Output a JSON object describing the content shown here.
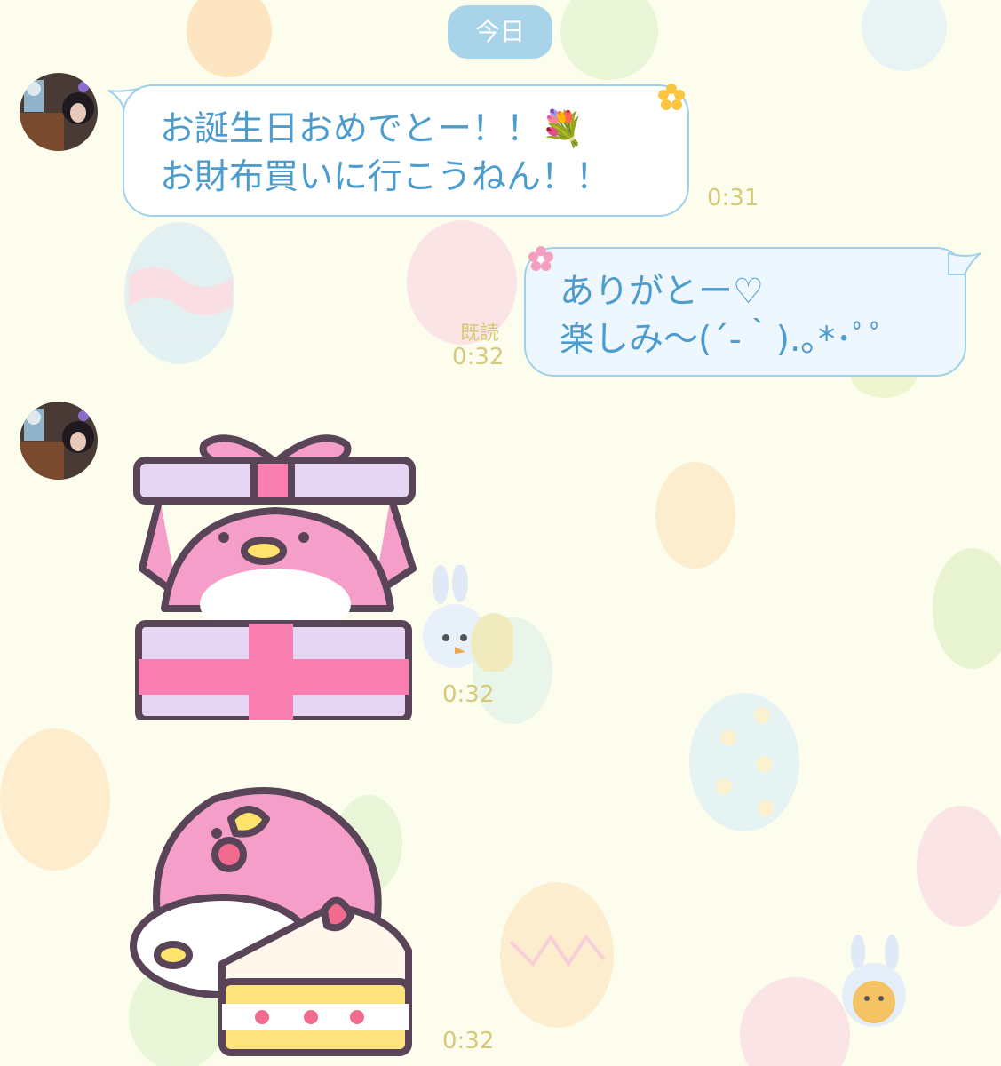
{
  "chat": {
    "date_divider": "今日",
    "messages": [
      {
        "sender": "friend",
        "type": "text",
        "lines": [
          "お誕生日おめでとー！！💐",
          "お財布買いに行こうねん！！"
        ],
        "time": "0:31"
      },
      {
        "sender": "me",
        "type": "text",
        "lines": [
          "ありがとー♡",
          "楽しみ〜(´-｀).｡*･ﾟﾟ"
        ],
        "time": "0:32",
        "status": "既読"
      },
      {
        "sender": "friend",
        "type": "sticker",
        "sticker": "pink-bird-gift-box-sticker",
        "time": "0:32"
      },
      {
        "sender": "friend",
        "type": "sticker",
        "sticker": "pink-bird-strawberry-cake-sticker",
        "time": "0:32"
      }
    ]
  },
  "colors": {
    "background": "#fdfdee",
    "date_pill": "#a8d4ea",
    "bubble_border": "#9fd0ea",
    "message_text": "#4c9ccd",
    "timestamp": "#d5c97a",
    "sticker_pink": "#f29ec6"
  },
  "icons": [
    "avatar",
    "flower-icon",
    "easter-egg-wallpaper",
    "bunny-plush-decoration"
  ]
}
